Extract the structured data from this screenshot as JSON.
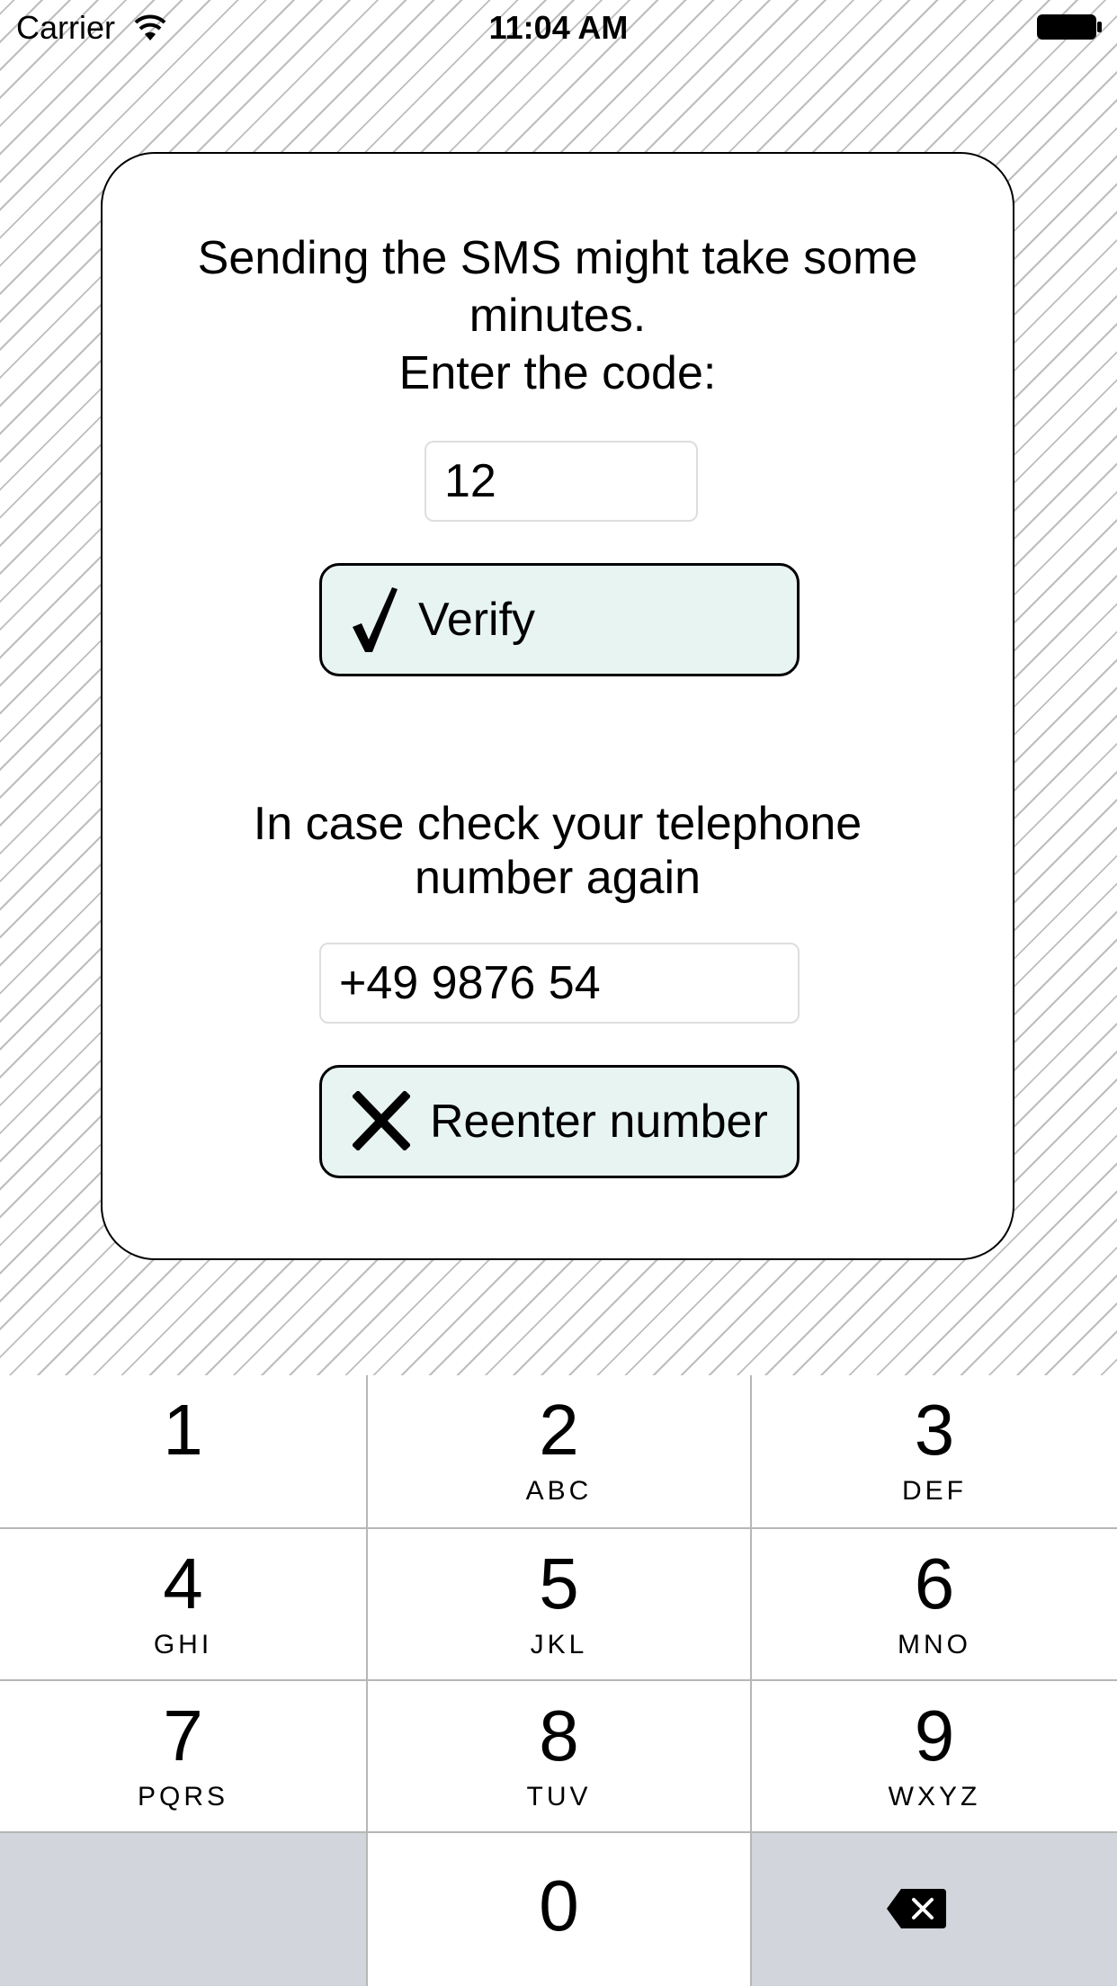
{
  "status_bar": {
    "carrier": "Carrier",
    "time": "11:04 AM",
    "icons": [
      "wifi-icon",
      "battery-icon"
    ]
  },
  "card": {
    "message": "Sending the SMS might take some\nminutes.\nEnter the code:",
    "code_value": "12",
    "verify_label": "Verify",
    "verify_icon": "checkmark-icon",
    "hint": "In case check your telephone\nnumber again",
    "phone_value": "+49 9876 54",
    "reenter_label": "Reenter number",
    "reenter_icon": "close-icon",
    "button_color": "#e8f4f2"
  },
  "keypad": {
    "keys": [
      {
        "digit": "1",
        "letters": ""
      },
      {
        "digit": "2",
        "letters": "ABC"
      },
      {
        "digit": "3",
        "letters": "DEF"
      },
      {
        "digit": "4",
        "letters": "GHI"
      },
      {
        "digit": "5",
        "letters": "JKL"
      },
      {
        "digit": "6",
        "letters": "MNO"
      },
      {
        "digit": "7",
        "letters": "PQRS"
      },
      {
        "digit": "8",
        "letters": "TUV"
      },
      {
        "digit": "9",
        "letters": "WXYZ"
      },
      {
        "digit": "0",
        "letters": ""
      }
    ],
    "delete_icon": "backspace-icon",
    "gray_key_color": "#d2d5db"
  }
}
